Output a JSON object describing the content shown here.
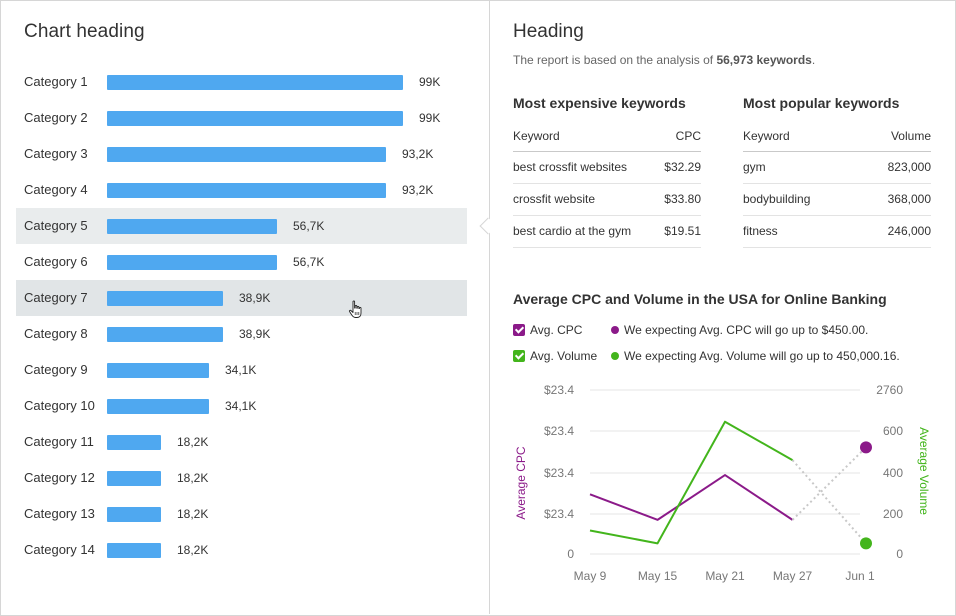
{
  "left": {
    "heading": "Chart heading",
    "max_value": 99,
    "rows": [
      {
        "label": "Category 1",
        "value": 99,
        "value_label": "99K"
      },
      {
        "label": "Category 2",
        "value": 99,
        "value_label": "99K"
      },
      {
        "label": "Category 3",
        "value": 93.2,
        "value_label": "93,2K"
      },
      {
        "label": "Category 4",
        "value": 93.2,
        "value_label": "93,2K"
      },
      {
        "label": "Category 5",
        "value": 56.7,
        "value_label": "56,7K"
      },
      {
        "label": "Category 6",
        "value": 56.7,
        "value_label": "56,7K"
      },
      {
        "label": "Category 7",
        "value": 38.9,
        "value_label": "38,9K"
      },
      {
        "label": "Category 8",
        "value": 38.9,
        "value_label": "38,9K"
      },
      {
        "label": "Category 9",
        "value": 34.1,
        "value_label": "34,1K"
      },
      {
        "label": "Category 10",
        "value": 34.1,
        "value_label": "34,1K"
      },
      {
        "label": "Category 11",
        "value": 18.2,
        "value_label": "18,2K"
      },
      {
        "label": "Category 12",
        "value": 18.2,
        "value_label": "18,2K"
      },
      {
        "label": "Category 13",
        "value": 18.2,
        "value_label": "18,2K"
      },
      {
        "label": "Category 14",
        "value": 18.2,
        "value_label": "18,2K"
      }
    ],
    "bar_color": "#4fa8f0"
  },
  "right": {
    "heading": "Heading",
    "subtitle_prefix": "The report is based on the analysis of ",
    "subtitle_count": "56,973 keywords",
    "subtitle_suffix": ".",
    "expensive": {
      "title": "Most expensive keywords",
      "col_keyword": "Keyword",
      "col_value": "CPC",
      "rows": [
        {
          "keyword": "best crossfit websites",
          "value": "$32.29"
        },
        {
          "keyword": "crossfit website",
          "value": "$33.80"
        },
        {
          "keyword": "best cardio at the gym",
          "value": "$19.51"
        }
      ]
    },
    "popular": {
      "title": "Most popular keywords",
      "col_keyword": "Keyword",
      "col_value": "Volume",
      "rows": [
        {
          "keyword": "gym",
          "value": "823,000"
        },
        {
          "keyword": "bodybuilding",
          "value": "368,000"
        },
        {
          "keyword": "fitness",
          "value": "246,000"
        }
      ]
    },
    "line_title": "Average CPC and Volume in the USA for Online Banking",
    "legend": {
      "cpc_label": "Avg. CPC",
      "cpc_note": "We expecting Avg. CPC will go up to $450.00.",
      "volume_label": "Avg. Volume",
      "volume_note": "We expecting Avg. Volume will go up to 450,000.16."
    },
    "colors": {
      "cpc": "#8b1a89",
      "volume": "#43b51c",
      "forecast": "#c8c8c8"
    }
  },
  "chart_data": {
    "type": "line",
    "x": [
      "May 9",
      "May 15",
      "May 21",
      "May 27",
      "Jun 1"
    ],
    "y_left_label": "Average CPC",
    "y_right_label": "Average Volume",
    "y_left_ticks": [
      "$23.4",
      "$23.4",
      "$23.4",
      "$23.4",
      "0"
    ],
    "y_right_ticks": [
      "2760",
      "600",
      "400",
      "200",
      "0"
    ],
    "y_right_range": [
      0,
      700
    ],
    "series": [
      {
        "name": "Avg. CPC",
        "axis": "right",
        "values": [
          280,
          160,
          370,
          160
        ],
        "forecast": 500
      },
      {
        "name": "Avg. Volume",
        "axis": "right",
        "values": [
          110,
          50,
          620,
          440
        ],
        "forecast": 50
      }
    ]
  }
}
